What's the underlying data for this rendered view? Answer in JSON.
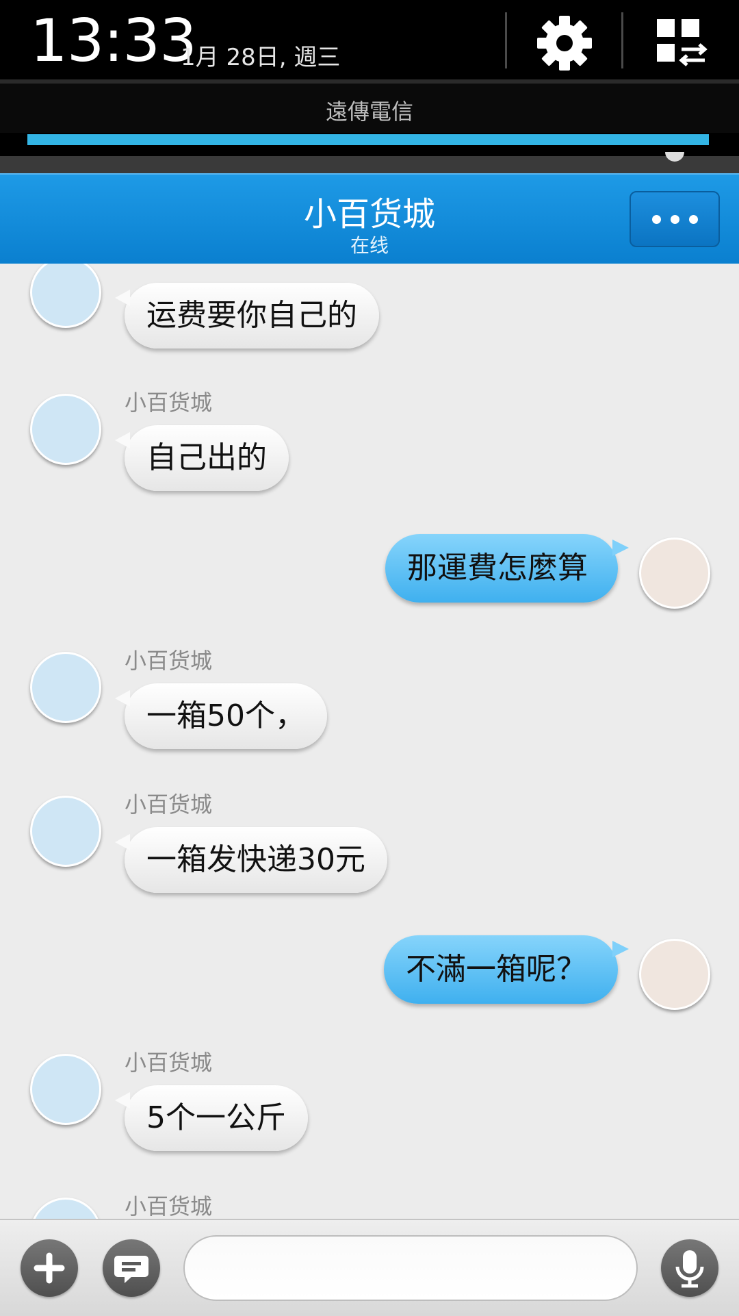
{
  "status": {
    "time": "13:33",
    "date": "1月 28日, 週三",
    "carrier": "遠傳電信",
    "signal_bar_fraction": 1.0,
    "icons": [
      "gear-icon",
      "quick-settings-icon"
    ]
  },
  "header": {
    "title": "小百货城",
    "subtitle": "在线",
    "more_icon": "more-dots-icon"
  },
  "messages": [
    {
      "from": "shop",
      "sender": "",
      "text": "运费要你自己的"
    },
    {
      "from": "shop",
      "sender": "小百货城",
      "text": "自己出的"
    },
    {
      "from": "me",
      "text": "那運費怎麼算"
    },
    {
      "from": "shop",
      "sender": "小百货城",
      "text": "一箱50个，"
    },
    {
      "from": "shop",
      "sender": "小百货城",
      "text": "一箱发快递30元"
    },
    {
      "from": "me",
      "text": "不滿一箱呢？"
    },
    {
      "from": "shop",
      "sender": "小百货城",
      "text": "5个一公斤"
    },
    {
      "from": "shop",
      "sender": "小百货城",
      "text": ""
    }
  ],
  "composer": {
    "value": "",
    "placeholder": "",
    "icons": [
      "plus-icon",
      "emoji-chat-icon",
      "microphone-icon"
    ]
  },
  "colors": {
    "header_blue": "#0a7fcf",
    "accent_bar": "#33b5e5",
    "outgoing_bubble": "#4fb8f2",
    "incoming_bubble": "#f5f5f5",
    "chat_bg": "#ececec"
  }
}
